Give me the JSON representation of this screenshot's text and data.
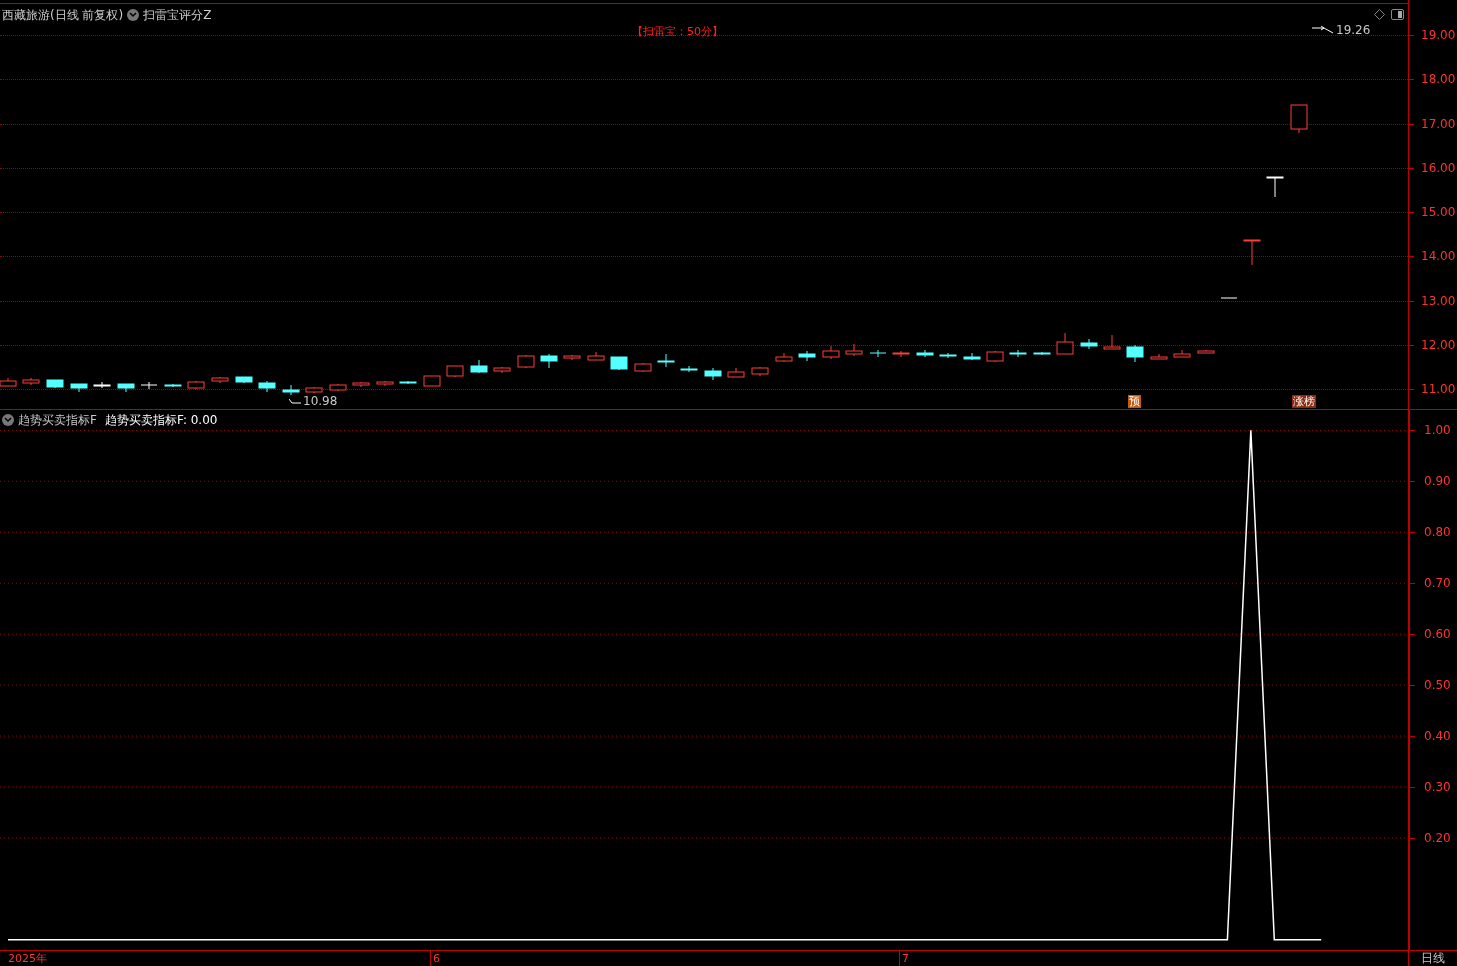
{
  "header": {
    "stock": "西藏旅游(日线 前复权)",
    "indicator": "扫雷宝评分Z"
  },
  "annotation": "【扫雷宝：50分】",
  "price_high_label": "19.26",
  "price_low_label": "10.98",
  "signal_markers": [
    {
      "text": "预",
      "kind": "forecast"
    },
    {
      "text": "涨榜",
      "kind": "limit"
    }
  ],
  "price_axis": [
    "19.00",
    "18.00",
    "17.00",
    "16.00",
    "15.00",
    "14.00",
    "13.00",
    "12.00",
    "11.00"
  ],
  "indicator_pane": {
    "reading": "趋势买卖指标F: 0.00",
    "chart_data": {
      "type": "line",
      "grid": true,
      "ylim": [
        -0.02,
        1.04
      ],
      "yticks": [
        {
          "value": 1,
          "label": "1.00"
        },
        {
          "value": 0.9,
          "label": "0.90"
        },
        {
          "value": 0.8,
          "label": "0.80"
        },
        {
          "value": 0.7,
          "label": "0.70"
        },
        {
          "value": 0.6,
          "label": "0.60"
        },
        {
          "value": 0.5,
          "label": "0.50"
        },
        {
          "value": 0.4,
          "label": "0.40"
        },
        {
          "value": 0.3,
          "label": "0.30"
        },
        {
          "value": 0.2,
          "label": "0.20"
        }
      ],
      "series": [
        {
          "name": "趋势买卖指标F",
          "color": "#ffffff",
          "values": [
            0,
            0,
            0,
            0,
            0,
            0,
            0,
            0,
            0,
            0,
            0,
            0,
            0,
            0,
            0,
            0,
            0,
            0,
            0,
            0,
            0,
            0,
            0,
            0,
            0,
            0,
            0,
            0,
            0,
            0,
            0,
            0,
            0,
            0,
            0,
            0,
            0,
            0,
            0,
            0,
            0,
            0,
            0,
            0,
            0,
            0,
            0,
            0,
            0,
            0,
            0,
            0,
            0,
            1,
            0,
            0,
            0
          ]
        }
      ]
    }
  },
  "time_axis": [
    "2025年",
    "6",
    "7"
  ],
  "period": "日线"
}
